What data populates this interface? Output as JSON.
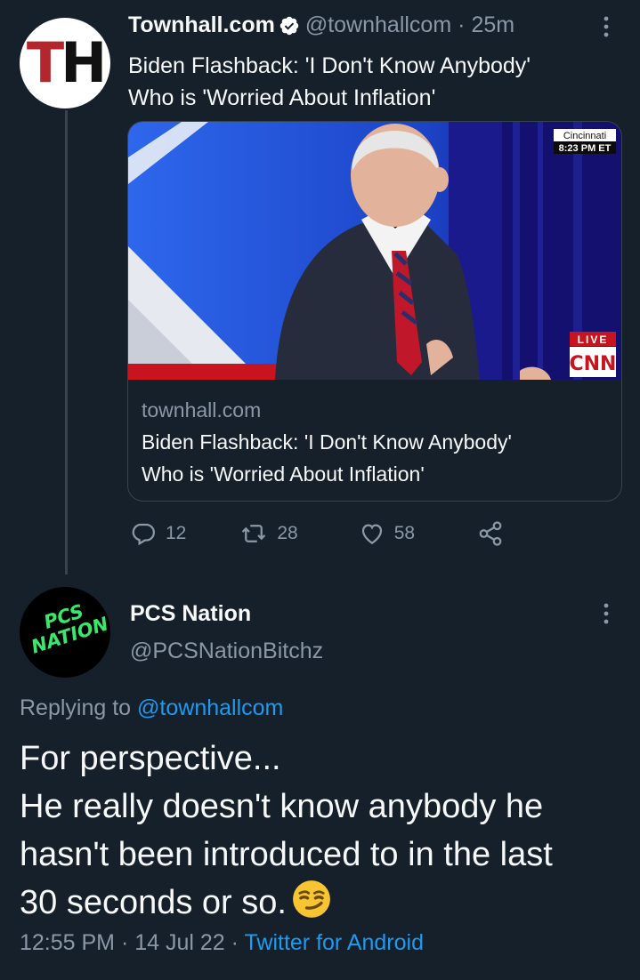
{
  "tweet1": {
    "avatar_text": "TH",
    "name": "Townhall.com",
    "handle": "@townhallcom",
    "separator": "·",
    "time": "25m",
    "text_line1": "Biden Flashback: 'I Don't Know Anybody'",
    "text_line2": "Who is 'Worried About Inflation'",
    "card": {
      "tv_location": "Cincinnati",
      "tv_time": "8:23 PM ET",
      "live_label": "LIVE",
      "network": "CNN",
      "domain": "townhall.com",
      "title_line1": "Biden Flashback: 'I Don't Know Anybody'",
      "title_line2": "Who is 'Worried About Inflation'"
    },
    "actions": {
      "replies": "12",
      "retweets": "28",
      "likes": "58"
    }
  },
  "tweet2": {
    "avatar_line1": "PCS",
    "avatar_line2": "NATION",
    "name": "PCS Nation",
    "handle": "@PCSNationBitchz",
    "replying_prefix": "Replying to",
    "replying_to": "@townhallcom",
    "line1": "For perspective...",
    "line2": "He really doesn't know anybody he",
    "line3": "hasn't been introduced to in the last",
    "line4": "30 seconds or so.",
    "time": "12:55 PM",
    "date": "14 Jul 22",
    "source": "Twitter for Android"
  },
  "colors": {
    "background": "#15202b",
    "muted": "#8b98a5",
    "accent": "#1d9bf0",
    "verified": "#ffffff"
  }
}
